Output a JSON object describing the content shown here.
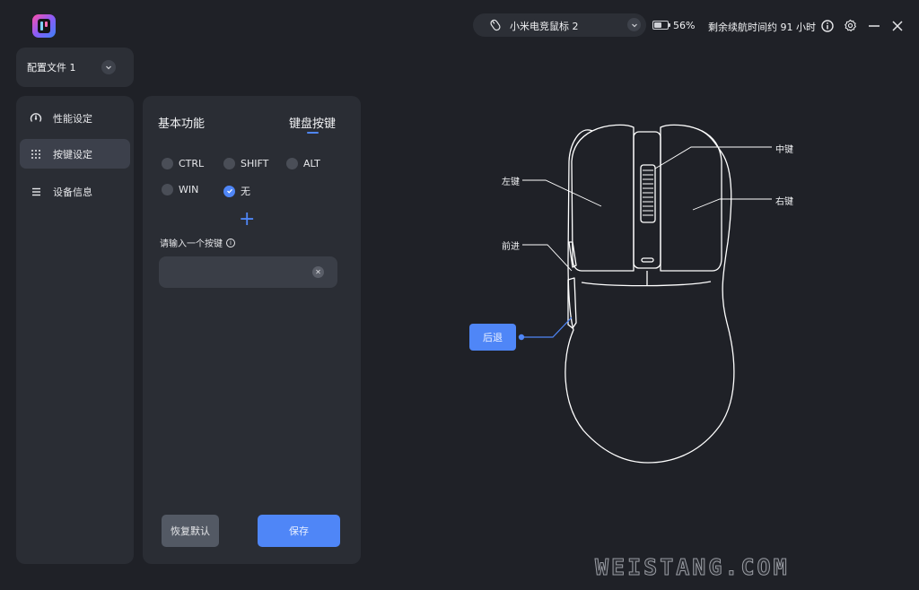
{
  "app": {
    "logo_icon": "app-logo-icon"
  },
  "profile": {
    "label": "配置文件 1"
  },
  "sidebar": {
    "items": [
      {
        "label": "性能设定",
        "icon": "dial-icon"
      },
      {
        "label": "按键设定",
        "icon": "keypad-icon",
        "active": true
      },
      {
        "label": "设备信息",
        "icon": "list-icon"
      }
    ]
  },
  "panel": {
    "tabs": [
      {
        "label": "基本功能"
      },
      {
        "label": "键盘按键",
        "active": true
      }
    ],
    "modifiers": [
      {
        "label": "CTRL",
        "checked": false
      },
      {
        "label": "SHIFT",
        "checked": false
      },
      {
        "label": "ALT",
        "checked": false
      },
      {
        "label": "WIN",
        "checked": false
      },
      {
        "label": "无",
        "checked": true
      }
    ],
    "input_label": "请输入一个按键",
    "input_value": "",
    "reset_label": "恢复默认",
    "save_label": "保存"
  },
  "topbar": {
    "device_name": "小米电竞鼠标 2",
    "battery_percent": "56%",
    "battery_level": 0.56,
    "remaining": "剩余续航时间约 91 小时"
  },
  "diagram": {
    "left_button": "左键",
    "middle_button": "中键",
    "right_button": "右键",
    "forward_button": "前进",
    "back_button": "后退"
  },
  "watermark": "WEISTANG.COM",
  "colors": {
    "accent": "#4f86f7",
    "background": "#1f2127",
    "panel": "#2a2d34"
  }
}
